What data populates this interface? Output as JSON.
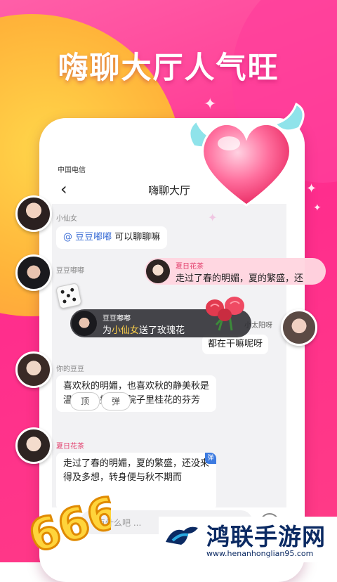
{
  "headline": "嗨聊大厅人气旺",
  "status_bar": {
    "carrier": "中国电信"
  },
  "nav": {
    "back_icon": "chevron-left-icon",
    "title": "嗨聊大厅"
  },
  "messages": [
    {
      "user": "小仙女",
      "mention": "@ 豆豆嘟嘟",
      "text": " 可以聊聊嘛"
    },
    {
      "user": "豆豆嘟嘟",
      "emoji": "dice-icon"
    },
    {
      "user": "你的豆豆",
      "text": "喜欢秋的明媚，也喜欢秋的静美秋是温婉的，如开在院子里桂花的芬芳"
    },
    {
      "user": "夏日花茶",
      "text": "走过了春的明媚，夏的繁盛，还没来得及多想，转身便与秋不期而",
      "badge": "弹"
    }
  ],
  "gift_banner": {
    "user": "豆豆嘟嘟",
    "prefix": "为",
    "target": "小仙女",
    "suffix": "送了玫瑰花",
    "gift_icon": "rose-bouquet-icon"
  },
  "barrage_banner": {
    "user": "夏日花茶",
    "text": "走过了春的明媚，夏的繁盛，还"
  },
  "side_message": {
    "user": "小太阳呀",
    "text": "都在干嘛呢呀"
  },
  "input": {
    "placeholder": "点什么吧 ..."
  },
  "quick_tags": [
    "顶",
    "弹"
  ],
  "decor": {
    "heart_icon": "winged-heart-icon",
    "badge_666": "666"
  },
  "watermark": {
    "name": "鸿联手游网",
    "url": "www.henanhonglian95.com"
  },
  "colors": {
    "accent_pink": "#ff2d8d",
    "accent_yellow": "#ffc53d",
    "mention_blue": "#3d6fd6"
  }
}
